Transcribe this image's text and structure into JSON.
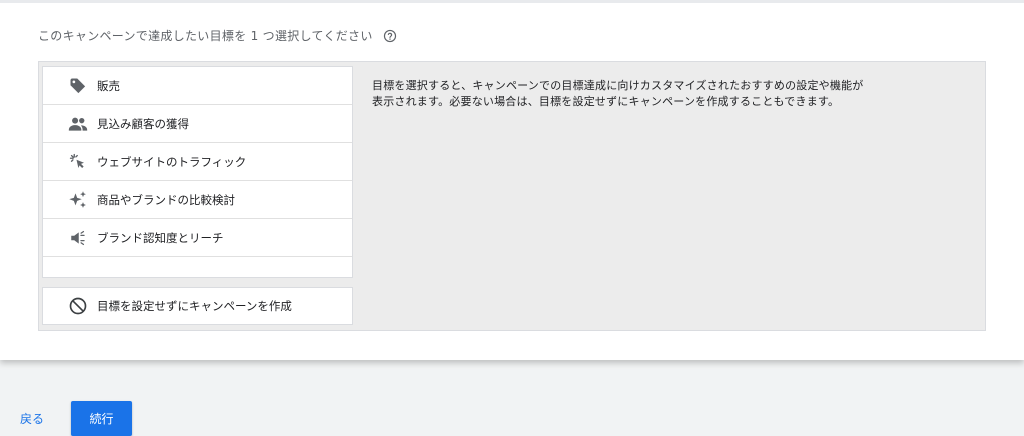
{
  "heading": "このキャンペーンで達成したい目標を 1 つ選択してください",
  "help_icon": "help-circle-icon",
  "goals": [
    {
      "label": "販売",
      "icon": "tag-icon"
    },
    {
      "label": "見込み顧客の獲得",
      "icon": "people-icon"
    },
    {
      "label": "ウェブサイトのトラフィック",
      "icon": "cursor-click-icon"
    },
    {
      "label": "商品やブランドの比較検討",
      "icon": "sparkle-icon"
    },
    {
      "label": "ブランド認知度とリーチ",
      "icon": "megaphone-icon"
    }
  ],
  "no_goal": {
    "label": "目標を設定せずにキャンペーンを作成",
    "icon": "block-icon"
  },
  "description_line1": "目標を選択すると、キャンペーンでの目標達成に向けカスタマイズされたおすすめの設定や機能が",
  "description_line2": "表示されます。必要ない場合は、目標を設定せずにキャンペーンを作成することもできます。",
  "footer": {
    "back_label": "戻る",
    "continue_label": "続行"
  },
  "colors": {
    "accent": "#1a73e8",
    "panel": "#ececec",
    "text": "#202124",
    "muted": "#5f6368"
  }
}
